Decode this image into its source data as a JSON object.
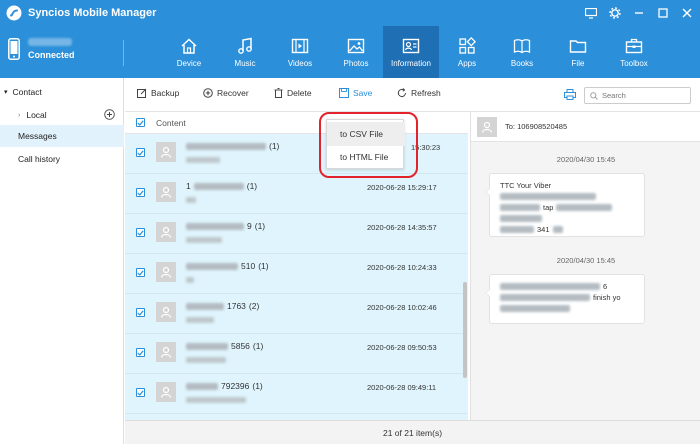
{
  "window": {
    "title": "Syncios Mobile Manager",
    "controls": [
      "monitor-icon",
      "gear-icon",
      "minimize-icon",
      "maximize-icon",
      "close-icon"
    ]
  },
  "device": {
    "status": "Connected"
  },
  "nav": {
    "items": [
      {
        "label": "Device",
        "icon": "home-icon"
      },
      {
        "label": "Music",
        "icon": "music-note-icon"
      },
      {
        "label": "Videos",
        "icon": "film-icon"
      },
      {
        "label": "Photos",
        "icon": "photo-icon"
      },
      {
        "label": "Information",
        "icon": "contact-card-icon",
        "active": true
      },
      {
        "label": "Apps",
        "icon": "apps-grid-icon"
      },
      {
        "label": "Books",
        "icon": "book-icon"
      },
      {
        "label": "File",
        "icon": "folder-icon"
      },
      {
        "label": "Toolbox",
        "icon": "toolbox-icon"
      }
    ]
  },
  "sidebar": {
    "contact": "Contact",
    "local": "Local",
    "messages": "Messages",
    "call_history": "Call history"
  },
  "toolbar": {
    "backup": "Backup",
    "recover": "Recover",
    "delete": "Delete",
    "save": "Save",
    "refresh": "Refresh",
    "search_placeholder": "Search"
  },
  "save_menu": {
    "to_csv": "to CSV File",
    "to_html": "to HTML File"
  },
  "list": {
    "header": "Content",
    "rows": [
      {
        "title_prefix": "",
        "title_tail": "",
        "count": "(1)",
        "date": "15:30:23"
      },
      {
        "title_prefix": "1",
        "title_tail": "",
        "count": "(1)",
        "date": "2020-06-28 15:29:17"
      },
      {
        "title_prefix": "",
        "title_tail": "9",
        "count": "(1)",
        "date": "2020-06-28 14:35:57"
      },
      {
        "title_prefix": "",
        "title_tail": "510",
        "count": "(1)",
        "date": "2020-06-28 10:24:33"
      },
      {
        "title_prefix": "",
        "title_tail": "1763",
        "count": "(2)",
        "date": "2020-06-28 10:02:46"
      },
      {
        "title_prefix": "",
        "title_tail": "5856",
        "count": "(1)",
        "date": "2020-06-28 09:50:53"
      },
      {
        "title_prefix": "",
        "title_tail": "792396",
        "count": "(1)",
        "date": "2020-06-28 09:49:11"
      }
    ]
  },
  "status": "21 of 21 item(s)",
  "conversation": {
    "to": "To: 106908520485",
    "messages": [
      {
        "time": "2020/04/30 15:45",
        "first_line": "TTC Your Viber",
        "tail_tap": "tap",
        "tail_num": "341"
      },
      {
        "time": "2020/04/30 15:45",
        "first_tail": "6",
        "second_tail": "finish yo"
      }
    ]
  }
}
